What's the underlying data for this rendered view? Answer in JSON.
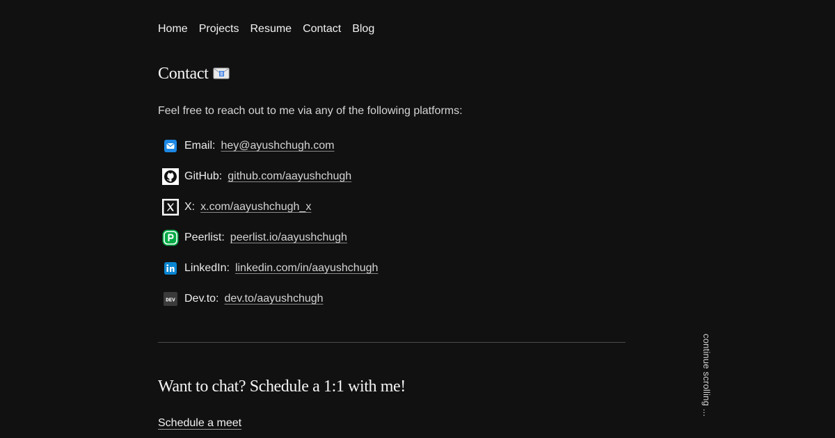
{
  "nav": {
    "items": [
      {
        "label": "Home"
      },
      {
        "label": "Projects"
      },
      {
        "label": "Resume"
      },
      {
        "label": "Contact"
      },
      {
        "label": "Blog"
      }
    ]
  },
  "page": {
    "title": "Contact",
    "title_icon": "envelope-emoji-icon",
    "intro": "Feel free to reach out to me via any of the following platforms:"
  },
  "contacts": [
    {
      "icon": "email-icon",
      "label": "Email:",
      "link": "hey@ayushchugh.com",
      "color": "#1e88e5"
    },
    {
      "icon": "github-icon",
      "label": "GitHub:",
      "link": "github.com/aayushchugh",
      "color": "#ffffff"
    },
    {
      "icon": "x-icon",
      "label": "X:",
      "link": "x.com/aayushchugh_x",
      "color": "#ffffff"
    },
    {
      "icon": "peerlist-icon",
      "label": "Peerlist:",
      "link": "peerlist.io/aayushchugh",
      "color": "#00aa45"
    },
    {
      "icon": "linkedin-icon",
      "label": "LinkedIn:",
      "link": "linkedin.com/in/aayushchugh",
      "color": "#0a85d1"
    },
    {
      "icon": "devto-icon",
      "label": "Dev.to:",
      "link": "dev.to/aayushchugh",
      "color": "#3a3a3a"
    }
  ],
  "chat": {
    "title": "Want to chat? Schedule a 1:1 with me!",
    "cta": "Schedule a meet"
  },
  "scroll_hint": "continue scrolling ...",
  "colors": {
    "background": "#111111",
    "text": "#e6e6e6",
    "divider": "#4a4a4a"
  }
}
